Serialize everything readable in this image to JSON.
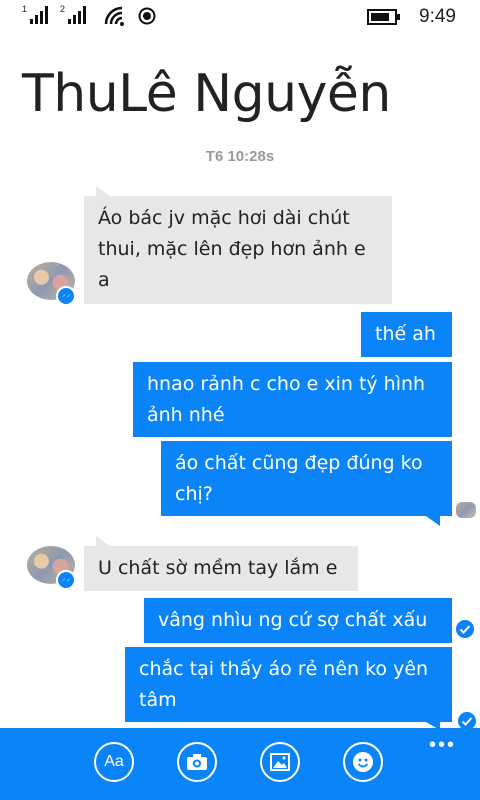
{
  "status": {
    "sim1_label": "1",
    "sim2_label": "2",
    "time": "9:49"
  },
  "header": {
    "contact_name": "ThuLê Nguyễn"
  },
  "conversation": {
    "timestamp": "T6 10:28s",
    "messages": [
      {
        "direction": "incoming",
        "text": "Áo bác jv mặc hơi dài chút thui, mặc lên đẹp hơn ảnh e a"
      },
      {
        "direction": "outgoing",
        "text": "thế ah"
      },
      {
        "direction": "outgoing",
        "text": "hnao rảnh c cho e xin tý hình ảnh nhé"
      },
      {
        "direction": "outgoing",
        "text": "áo chất cũng đẹp đúng ko chị?"
      },
      {
        "direction": "incoming",
        "text": "U chất sờ mềm tay lắm e"
      },
      {
        "direction": "outgoing",
        "text": "vâng nhìu ng cứ sợ chất xấu"
      },
      {
        "direction": "outgoing",
        "text": "chắc tại thấy áo rẻ nên ko yên tâm"
      }
    ]
  },
  "appbar": {
    "text_button_label": "Aa",
    "more_label": "•••"
  },
  "colors": {
    "accent": "#0a84f6",
    "incoming_bubble": "#e7e7e7"
  }
}
